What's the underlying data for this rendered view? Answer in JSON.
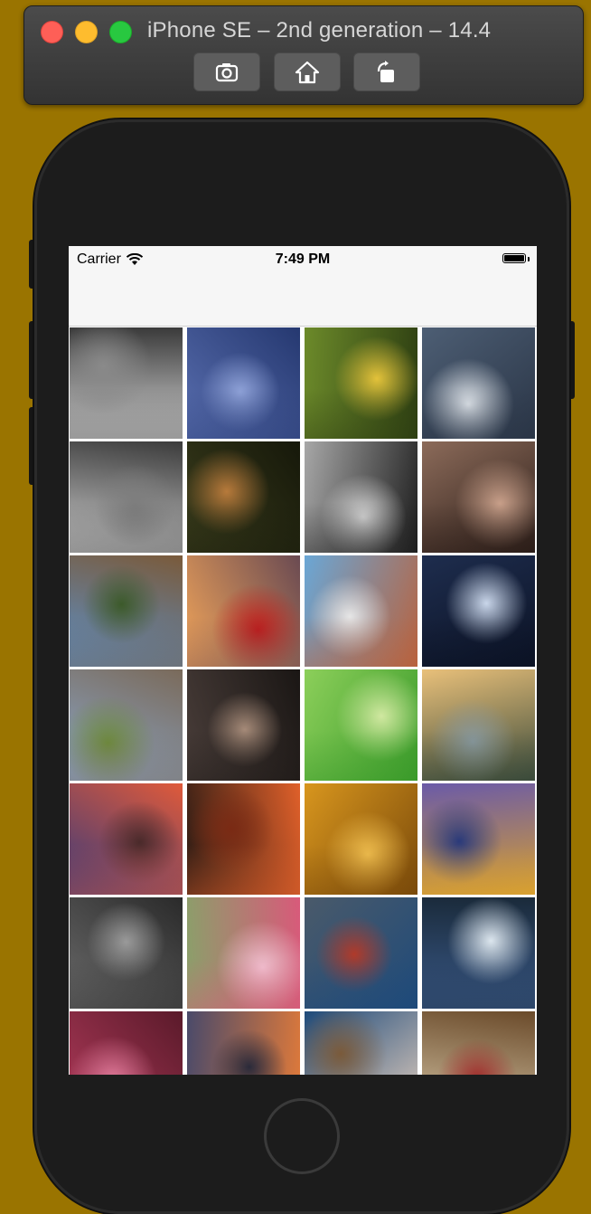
{
  "simulator": {
    "title": "iPhone SE – 2nd generation – 14.4",
    "toolbar": [
      {
        "icon": "screenshot-icon"
      },
      {
        "icon": "home-icon"
      },
      {
        "icon": "rotate-icon"
      }
    ]
  },
  "status_bar": {
    "carrier": "Carrier",
    "time": "7:49 PM",
    "battery_level": 1.0
  },
  "photos": [
    {
      "desc": "black and white lake with trees",
      "colors": [
        "#d8d8d8",
        "#3a3a3a",
        "#8a8a8a"
      ]
    },
    {
      "desc": "blue underwater abstract",
      "colors": [
        "#5a6fb0",
        "#253870",
        "#8fa2d8"
      ]
    },
    {
      "desc": "yellow bird on green reeds",
      "colors": [
        "#6c8a2a",
        "#2e3f12",
        "#e3c23a"
      ]
    },
    {
      "desc": "lighthouse with crashing wave",
      "colors": [
        "#4d5e74",
        "#2a3546",
        "#e8edf2"
      ]
    },
    {
      "desc": "black and white karst landscape",
      "colors": [
        "#cfcfcf",
        "#3b3b3b",
        "#7d7d7d"
      ]
    },
    {
      "desc": "hummingbird on dark background",
      "colors": [
        "#3a3d1c",
        "#16180a",
        "#b77a3b"
      ]
    },
    {
      "desc": "black and white group of people",
      "colors": [
        "#a7a7a7",
        "#1e1e1e",
        "#d9d9d9"
      ]
    },
    {
      "desc": "portrait of woman",
      "colors": [
        "#8c6b5a",
        "#2b1d18",
        "#c9a08a"
      ]
    },
    {
      "desc": "canyon cliffs and lake",
      "colors": [
        "#5c8fc6",
        "#7a5a3a",
        "#3c5a2a"
      ]
    },
    {
      "desc": "sunset dunes with red figure",
      "colors": [
        "#f0a45a",
        "#6a4a52",
        "#c01a1a"
      ]
    },
    {
      "desc": "coastal town with blue sea",
      "colors": [
        "#6aa7d6",
        "#b8623e",
        "#e6e6e6"
      ]
    },
    {
      "desc": "wolf face in night sky",
      "colors": [
        "#1e2d4e",
        "#0b1224",
        "#c9d6ea"
      ]
    },
    {
      "desc": "mountains over green valley",
      "colors": [
        "#8aa6c8",
        "#7a6a5a",
        "#6c8a3a"
      ]
    },
    {
      "desc": "face behind wet glass",
      "colors": [
        "#4a3e3a",
        "#1a1614",
        "#a58a78"
      ]
    },
    {
      "desc": "small bird on green stem",
      "colors": [
        "#8ccf5a",
        "#3a9a2a",
        "#d0e8a0"
      ]
    },
    {
      "desc": "misty river at sunrise",
      "colors": [
        "#e9c07a",
        "#3a4a3a",
        "#8a9aa0"
      ]
    },
    {
      "desc": "dramatic sunset over rocks",
      "colors": [
        "#3a3a7a",
        "#e05a3a",
        "#4a2a2a"
      ]
    },
    {
      "desc": "glowing lava field",
      "colors": [
        "#2a1a14",
        "#e0602a",
        "#7a2a14"
      ]
    },
    {
      "desc": "golden leaves close-up",
      "colors": [
        "#d8961e",
        "#7a4a0a",
        "#f2c050"
      ]
    },
    {
      "desc": "autumn mountain lake reflection",
      "colors": [
        "#6a5aa8",
        "#d8a030",
        "#2a3a7a"
      ]
    },
    {
      "desc": "stormy mountain valley",
      "colors": [
        "#6a6a6a",
        "#2a2a2a",
        "#9a9a9a"
      ]
    },
    {
      "desc": "pink blossoms on branch",
      "colors": [
        "#8aa06a",
        "#d85a7a",
        "#f0c0d0"
      ]
    },
    {
      "desc": "boat bow facing stormy sea",
      "colors": [
        "#4a5a6a",
        "#1e4a7a",
        "#b03a2a"
      ]
    },
    {
      "desc": "snowy landscape aerial",
      "colors": [
        "#3a5a8a",
        "#1a2a3a",
        "#dce6ee"
      ]
    },
    {
      "desc": "red autumn tree canopy",
      "colors": [
        "#b03a5a",
        "#5a1a2a",
        "#e07a9a"
      ]
    },
    {
      "desc": "city skyline at dusk",
      "colors": [
        "#4a4a6a",
        "#e07a3a",
        "#2a2a3a"
      ]
    },
    {
      "desc": "white flower on blue",
      "colors": [
        "#1e4a7a",
        "#e8d2c0",
        "#7a5a3a"
      ]
    },
    {
      "desc": "interior wall with pictures",
      "colors": [
        "#d8c8a8",
        "#6a4a2a",
        "#a02a2a"
      ]
    }
  ]
}
